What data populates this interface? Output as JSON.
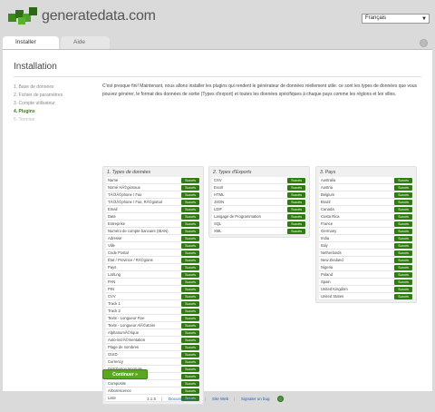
{
  "app": {
    "brand": "generatedata.com",
    "language": "Français"
  },
  "tabs": [
    {
      "label": "Installer"
    },
    {
      "label": "Aide"
    }
  ],
  "page": {
    "title": "Installation",
    "steps": [
      "1. Base de données",
      "2. Fichier de paramètres",
      "3. Compte utilisateur",
      "4. Plugins",
      "5. Terminé"
    ],
    "intro": "C'est presque fini! Maintenant, nous allons installer les plugins qui rendent le générateur de données réellement utile: ce sont les types de données que vous pouvez générer, le format des données de sortie (Types d'export) et toutes les données spécifiques à chaque pays comme les régions et les villes.",
    "status_label": "Succès",
    "continue_label": "Continuer »"
  },
  "columns": [
    {
      "heading": "1. Types de données",
      "items": [
        "Name",
        "Nomé HÃ©gionaux",
        "TÃ©lÃ©phone / Fax",
        "TÃ©lÃ©phone / Fax, RÃ©gional",
        "Email",
        "Date",
        "Entreprise",
        "Numéro de compte bancaire (IBAN)",
        "Adresse",
        "Ville",
        "Code Postal",
        "État / Province / RÃ©gions",
        "Pays",
        "Lat/Lng",
        "PAN",
        "PIN",
        "CVV",
        "Track 1",
        "Track 2",
        "Texte - Longueur Fixe",
        "Texte - Longueur AlÃ©atoire",
        "AlphanumÃ©rique",
        "Auto-incrÃ©mentation",
        "Plage de nombres",
        "GUID",
        "Currency",
        "Distribution Normale",
        "Constante",
        "Composite",
        "Arborescence",
        "Liste"
      ]
    },
    {
      "heading": "2. Types d'Exports",
      "items": [
        "CSV",
        "Excel",
        "HTML",
        "JSON",
        "LDIF",
        "Langage de Programmation",
        "SQL",
        "XML"
      ]
    },
    {
      "heading": "3. Pays",
      "items": [
        "Australia",
        "Austria",
        "Belgium",
        "Brazil",
        "Canada",
        "Costa Rica",
        "France",
        "Germany",
        "India",
        "Italy",
        "Netherlands",
        "New Zealand",
        "Nigeria",
        "Poland",
        "Spain",
        "United Kingdom",
        "United States"
      ]
    }
  ],
  "footer": {
    "version": "3.1.5",
    "documentation": "Documentation",
    "website": "Site Web",
    "report_bug": "Signaler un bug"
  }
}
